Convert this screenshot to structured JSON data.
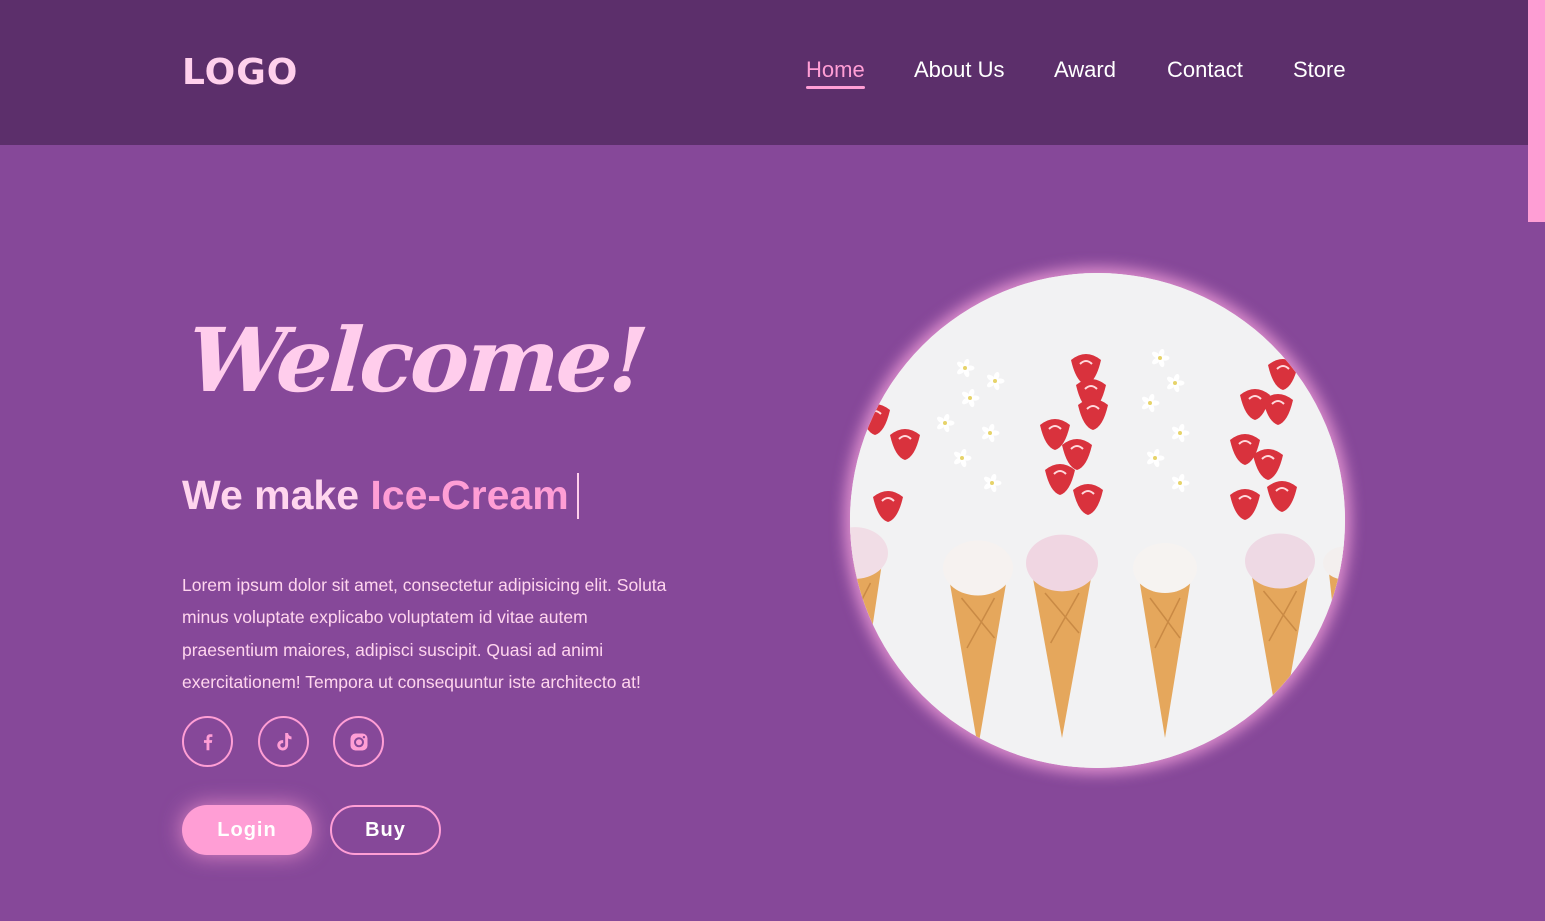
{
  "header": {
    "logo": "LOGO",
    "nav": [
      {
        "label": "Home",
        "active": true
      },
      {
        "label": "About Us",
        "active": false
      },
      {
        "label": "Award",
        "active": false
      },
      {
        "label": "Contact",
        "active": false
      },
      {
        "label": "Store",
        "active": false
      }
    ]
  },
  "hero": {
    "welcome": "Welcome!",
    "tagline_prefix": "We make ",
    "tagline_accent": "Ice-Cream",
    "description": "Lorem ipsum dolor sit amet, consectetur adipisicing elit. Soluta minus voluptate explicabo voluptatem id vitae autem praesentium maiores, adipisci suscipit. Quasi ad animi exercitationem! Tempora ut consequuntur iste architecto at!",
    "socials": [
      {
        "icon": "facebook-icon"
      },
      {
        "icon": "tiktok-icon"
      },
      {
        "icon": "instagram-icon"
      }
    ],
    "login_label": "Login",
    "buy_label": "Buy",
    "image": {
      "subject": "ice-cream-cones-photo"
    }
  },
  "colors": {
    "header_bg": "#5c2f6b",
    "page_bg": "#864899",
    "accent_pink": "#ff9ed5",
    "light_pink": "#ffd0ec"
  }
}
